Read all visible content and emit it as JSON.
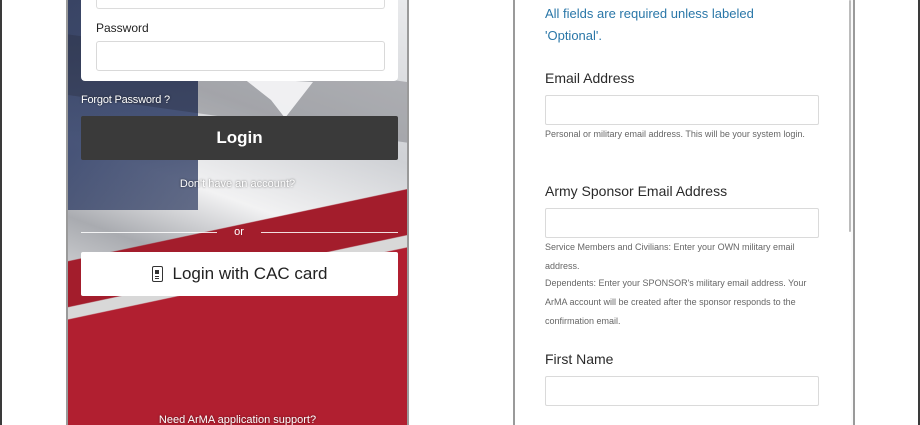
{
  "login": {
    "password_label": "Password",
    "forgot_password": "Forgot Password ?",
    "login_button": "Login",
    "no_account": "Don't have an account?",
    "or": "or",
    "cac_button": "Login with CAC card",
    "support": "Need ArMA application support?"
  },
  "form": {
    "required_note": "All fields are required unless labeled 'Optional'.",
    "email_label": "Email Address",
    "email_value": "",
    "email_help": "Personal or military email address. This will be your system login.",
    "sponsor_label": "Army Sponsor Email Address",
    "sponsor_value": "",
    "sponsor_help_1": "Service Members and Civilians: Enter your OWN military email address.",
    "sponsor_help_2": "Dependents: Enter your SPONSOR's military email address. Your ArMA account will be created after the sponsor responds to the confirmation email.",
    "first_name_label": "First Name",
    "first_name_value": ""
  },
  "icons": {
    "cac": "cac-card-icon"
  }
}
